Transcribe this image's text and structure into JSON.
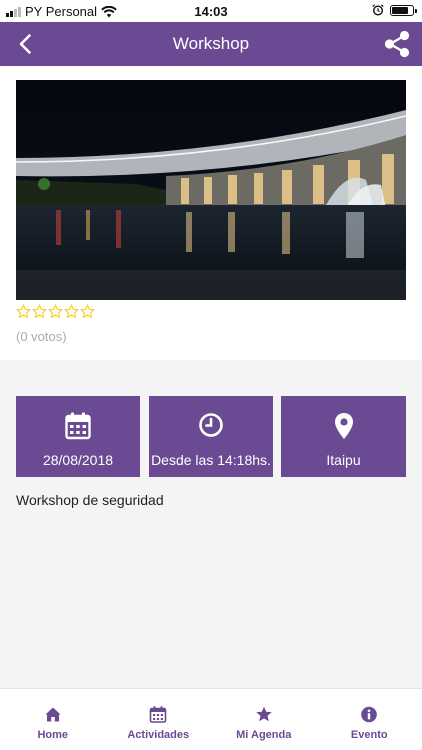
{
  "status_bar": {
    "carrier": "PY Personal",
    "time": "14:03",
    "battery_level": 0.85,
    "signal_bars": 2
  },
  "header": {
    "title": "Workshop",
    "back_icon": "chevron-left-icon",
    "share_icon": "share-icon"
  },
  "event": {
    "rating": 0,
    "max_rating": 5,
    "votes_text": "(0 votos)",
    "description": "Workshop de seguridad"
  },
  "info_tiles": [
    {
      "icon": "calendar-icon",
      "label": "28/08/2018"
    },
    {
      "icon": "clock-icon",
      "label": "Desde las 14:18hs."
    },
    {
      "icon": "location-pin-icon",
      "label": "Itaipu"
    }
  ],
  "tab_bar": [
    {
      "icon": "home-icon",
      "label": "Home"
    },
    {
      "icon": "calendar-icon",
      "label": "Actividades"
    },
    {
      "icon": "star-icon",
      "label": "Mi Agenda"
    },
    {
      "icon": "info-icon",
      "label": "Evento"
    }
  ],
  "colors": {
    "primary": "#6a4b93",
    "star_outline": "#f1d21c",
    "muted_text": "#a6aab1",
    "background": "#f4f4f4"
  }
}
